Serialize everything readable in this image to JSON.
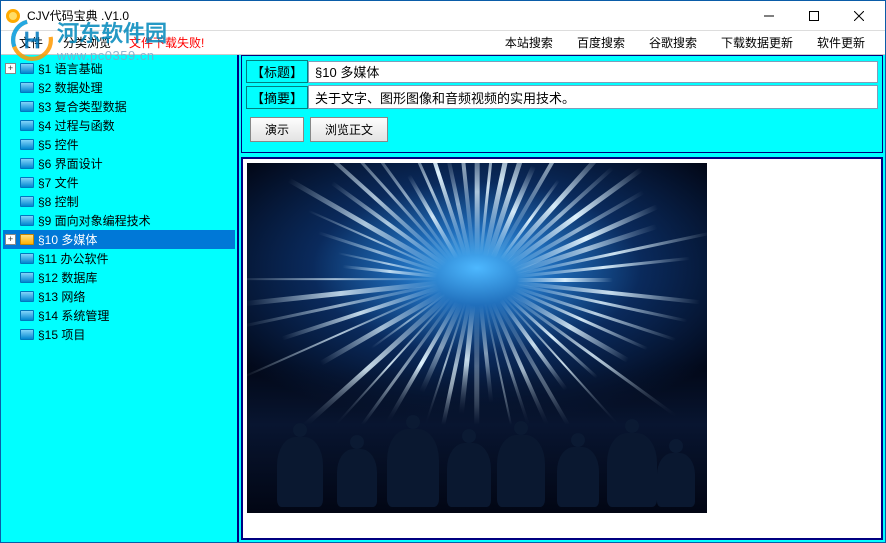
{
  "window": {
    "title": "CJV代码宝典 .V1.0"
  },
  "menu": {
    "file": "文件",
    "browse": "分类浏览",
    "message": "文件下载失败!",
    "site_search": "本站搜索",
    "baidu_search": "百度搜索",
    "google_search": "谷歌搜索",
    "download_update": "下载数据更新",
    "software_update": "软件更新"
  },
  "watermark": {
    "text": "河东软件园",
    "url": "www.pc0359.cn"
  },
  "tree": {
    "items": [
      {
        "id": "1",
        "label": "§1  语言基础",
        "expand": "+"
      },
      {
        "id": "2",
        "label": "§2  数据处理",
        "expand": ""
      },
      {
        "id": "3",
        "label": "§3  复合类型数据",
        "expand": ""
      },
      {
        "id": "4",
        "label": "§4  过程与函数",
        "expand": ""
      },
      {
        "id": "5",
        "label": "§5  控件",
        "expand": ""
      },
      {
        "id": "6",
        "label": "§6  界面设计",
        "expand": ""
      },
      {
        "id": "7",
        "label": "§7  文件",
        "expand": ""
      },
      {
        "id": "8",
        "label": "§8  控制",
        "expand": ""
      },
      {
        "id": "9",
        "label": "§9  面向对象编程技术",
        "expand": ""
      },
      {
        "id": "10",
        "label": "§10  多媒体",
        "expand": "+",
        "selected": true
      },
      {
        "id": "11",
        "label": "§11  办公软件",
        "expand": ""
      },
      {
        "id": "12",
        "label": "§12  数据库",
        "expand": ""
      },
      {
        "id": "13",
        "label": "§13  网络",
        "expand": ""
      },
      {
        "id": "14",
        "label": "§14  系统管理",
        "expand": ""
      },
      {
        "id": "15",
        "label": "§15  项目",
        "expand": ""
      }
    ]
  },
  "detail": {
    "title_label": "【标题】",
    "title_value": "§10 多媒体",
    "summary_label": "【摘要】",
    "summary_value": "关于文字、图形图像和音频视频的实用技术。",
    "btn_demo": "演示",
    "btn_view": "浏览正文"
  }
}
